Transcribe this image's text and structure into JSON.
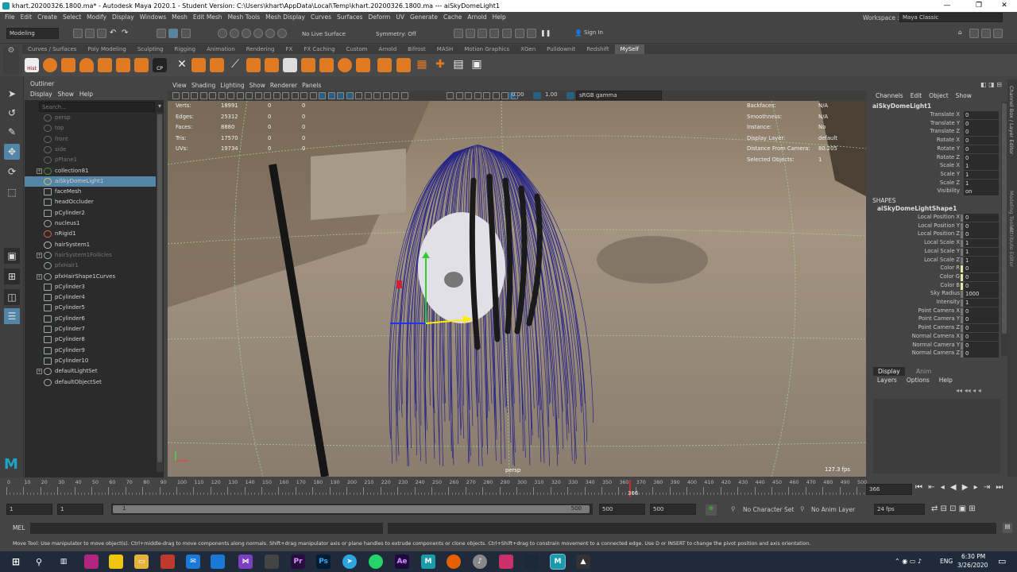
{
  "window": {
    "title": "khart.20200326.1800.ma* - Autodesk Maya 2020.1 - Student Version: C:\\Users\\khart\\AppData\\Local\\Temp\\khart.20200326.1800.ma  ---  aiSkyDomeLight1",
    "minimize": "—",
    "maximize": "❐",
    "close": "✕"
  },
  "menubar": [
    "File",
    "Edit",
    "Create",
    "Select",
    "Modify",
    "Display",
    "Windows",
    "Mesh",
    "Edit Mesh",
    "Mesh Tools",
    "Mesh Display",
    "Curves",
    "Surfaces",
    "Deform",
    "UV",
    "Generate",
    "Cache",
    "Arnold",
    "Help"
  ],
  "workspace": {
    "label": "Workspace :",
    "value": "Maya Classic"
  },
  "statusline": {
    "mode": "Modeling",
    "live_surface": "No Live Surface",
    "symmetry": "Symmetry: Off",
    "sign_in": "Sign In"
  },
  "shelf_tabs": [
    "Curves / Surfaces",
    "Poly Modeling",
    "Sculpting",
    "Rigging",
    "Animation",
    "Rendering",
    "FX",
    "FX Caching",
    "Custom",
    "Arnold",
    "Bifrost",
    "MASH",
    "Motion Graphics",
    "XGen",
    "Pulldownit",
    "Redshift",
    "MySelf"
  ],
  "shelf_active": "MySelf",
  "shelf_badges": {
    "hist": "Hist",
    "cp": "CP"
  },
  "outliner": {
    "title": "Outliner",
    "menu": [
      "Display",
      "Show",
      "Help"
    ],
    "search_placeholder": "Search...",
    "items": [
      {
        "label": "persp",
        "dim": true
      },
      {
        "label": "top",
        "dim": true
      },
      {
        "label": "front",
        "dim": true
      },
      {
        "label": "side",
        "dim": true
      },
      {
        "label": "pPlane1",
        "dim": true
      },
      {
        "label": "collection81",
        "dim": false
      },
      {
        "label": "aiSkyDomeLight1",
        "dim": false
      },
      {
        "label": "faceMesh",
        "dim": false
      },
      {
        "label": "headOccluder",
        "dim": false
      },
      {
        "label": "pCylinder2",
        "dim": false
      },
      {
        "label": "nucleus1",
        "dim": false
      },
      {
        "label": "nRigid1",
        "dim": false
      },
      {
        "label": "hairSystem1",
        "dim": false
      },
      {
        "label": "hairSystem1Follicles",
        "dim": true
      },
      {
        "label": "pfxHair1",
        "dim": true
      },
      {
        "label": "pfxHairShape1Curves",
        "dim": false
      },
      {
        "label": "pCylinder3",
        "dim": false
      },
      {
        "label": "pCylinder4",
        "dim": false
      },
      {
        "label": "pCylinder5",
        "dim": false
      },
      {
        "label": "pCylinder6",
        "dim": false
      },
      {
        "label": "pCylinder7",
        "dim": false
      },
      {
        "label": "pCylinder8",
        "dim": false
      },
      {
        "label": "pCylinder9",
        "dim": false
      },
      {
        "label": "pCylinder10",
        "dim": false
      },
      {
        "label": "defaultLightSet",
        "dim": false
      },
      {
        "label": "defaultObjectSet",
        "dim": false
      }
    ],
    "selected": "aiSkyDomeLight1"
  },
  "viewport": {
    "menu": [
      "View",
      "Shading",
      "Lighting",
      "Show",
      "Renderer",
      "Panels"
    ],
    "exposure": "0.00",
    "gamma": "1.00",
    "colorspace": "sRGB gamma",
    "camera": "persp",
    "fps": "127.3 fps",
    "hud_left": [
      {
        "label": "Verts:",
        "v1": "18991",
        "v2": "0",
        "v3": "0"
      },
      {
        "label": "Edges:",
        "v1": "25312",
        "v2": "0",
        "v3": "0"
      },
      {
        "label": "Faces:",
        "v1": "8880",
        "v2": "0",
        "v3": "0"
      },
      {
        "label": "Tris:",
        "v1": "17570",
        "v2": "0",
        "v3": "0"
      },
      {
        "label": "UVs:",
        "v1": "19734",
        "v2": "0",
        "v3": "0"
      }
    ],
    "hud_right": [
      {
        "label": "Backfaces:",
        "value": "N/A"
      },
      {
        "label": "Smoothness:",
        "value": "N/A"
      },
      {
        "label": "Instance:",
        "value": "No"
      },
      {
        "label": "Display Layer:",
        "value": "default"
      },
      {
        "label": "Distance From Camera:",
        "value": "80.205"
      },
      {
        "label": "Selected Objects:",
        "value": "1"
      }
    ]
  },
  "channelbox": {
    "menu": [
      "Channels",
      "Edit",
      "Object",
      "Show"
    ],
    "object": "aiSkyDomeLight1",
    "transform": [
      {
        "name": "Translate X",
        "value": "0"
      },
      {
        "name": "Translate Y",
        "value": "0"
      },
      {
        "name": "Translate Z",
        "value": "0"
      },
      {
        "name": "Rotate X",
        "value": "0"
      },
      {
        "name": "Rotate Y",
        "value": "0"
      },
      {
        "name": "Rotate Z",
        "value": "0"
      },
      {
        "name": "Scale X",
        "value": "1"
      },
      {
        "name": "Scale Y",
        "value": "1"
      },
      {
        "name": "Scale Z",
        "value": "1"
      },
      {
        "name": "Visibility",
        "value": "on"
      }
    ],
    "shapes_label": "SHAPES",
    "shape_name": "aiSkyDomeLightShape1",
    "shape": [
      {
        "name": "Local Position X",
        "value": "0"
      },
      {
        "name": "Local Position Y",
        "value": "0"
      },
      {
        "name": "Local Position Z",
        "value": "0"
      },
      {
        "name": "Local Scale X",
        "value": "1"
      },
      {
        "name": "Local Scale Y",
        "value": "1"
      },
      {
        "name": "Local Scale Z",
        "value": "1"
      },
      {
        "name": "Color R",
        "value": "0"
      },
      {
        "name": "Color G",
        "value": "0"
      },
      {
        "name": "Color B",
        "value": "0"
      },
      {
        "name": "Sky Radius",
        "value": "1000"
      },
      {
        "name": "Intensity",
        "value": "1"
      },
      {
        "name": "Point Camera X",
        "value": "0"
      },
      {
        "name": "Point Camera Y",
        "value": "0"
      },
      {
        "name": "Point Camera Z",
        "value": "0"
      },
      {
        "name": "Normal Camera X",
        "value": "0"
      },
      {
        "name": "Normal Camera Y",
        "value": "0"
      },
      {
        "name": "Normal Camera Z",
        "value": "0"
      }
    ],
    "side_tabs": [
      "Channel Box / Layer Editor",
      "Modeling Toolkit",
      "Attribute Editor"
    ]
  },
  "layer_editor": {
    "tabs": [
      "Display",
      "Anim"
    ],
    "menu": [
      "Layers",
      "Options",
      "Help"
    ]
  },
  "timeline": {
    "ticks": [
      "0",
      "10",
      "20",
      "30",
      "40",
      "50",
      "60",
      "70",
      "80",
      "90",
      "100",
      "110",
      "120",
      "130",
      "140",
      "150",
      "160",
      "170",
      "180",
      "190",
      "200",
      "210",
      "220",
      "230",
      "240",
      "250",
      "260",
      "270",
      "280",
      "290",
      "300",
      "310",
      "320",
      "330",
      "340",
      "350",
      "360",
      "370",
      "380",
      "390",
      "400",
      "410",
      "420",
      "430",
      "440",
      "450",
      "460",
      "470",
      "480",
      "490",
      "500"
    ],
    "current_frame": "366",
    "current_field": "366"
  },
  "range": {
    "start": "1",
    "anim_start": "1",
    "slider_start": "1",
    "slider_end": "500",
    "end": "500",
    "anim_end": "500",
    "character_set": "No Character Set",
    "anim_layer": "No Anim Layer",
    "fps": "24 fps"
  },
  "cmdline": {
    "label": "MEL"
  },
  "helpline": "Move Tool: Use manipulator to move object(s). Ctrl+middle-drag to move components along normals. Shift+drag manipulator axis or plane handles to extrude components or clone objects. Ctrl+Shift+drag to constrain movement to a connected edge. Use D or INSERT to change the pivot position and axis orientation.",
  "taskbar": {
    "time": "6:30 PM",
    "date": "3/26/2020",
    "lang": "ENG"
  },
  "colors": {
    "selection": "#5285a6",
    "hair": "#1a1a8a",
    "timeline_marker": "#c03030"
  }
}
